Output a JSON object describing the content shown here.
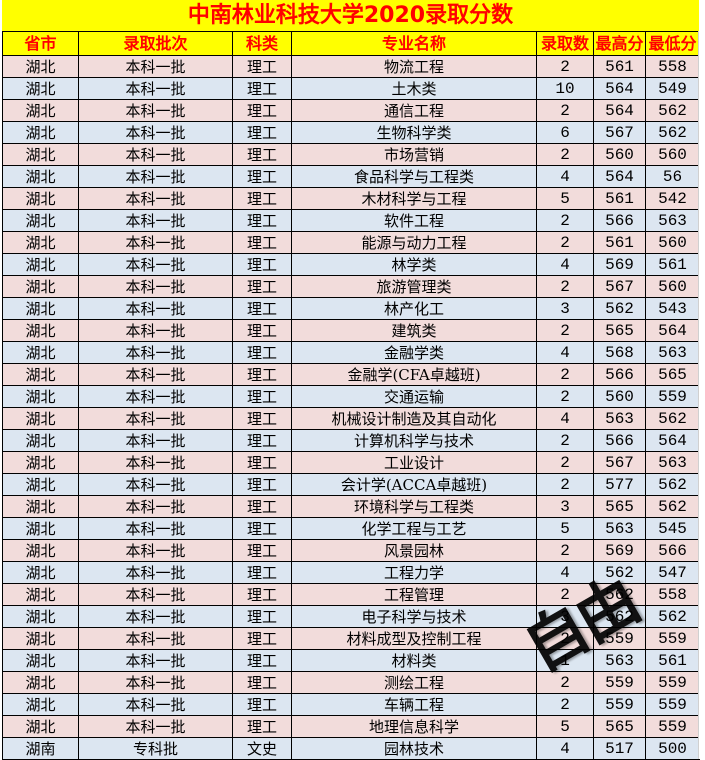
{
  "title": "中南林业科技大学2020录取分数",
  "colors": {
    "header_bg": "#ffff00",
    "header_text": "#ff0000",
    "row_pink": "#f2dcdb",
    "row_blue": "#dce6f1"
  },
  "table": {
    "headers": [
      "省市",
      "录取批次",
      "科类",
      "专业名称",
      "录取数",
      "最高分",
      "最低分"
    ],
    "rows": [
      [
        "湖北",
        "本科一批",
        "理工",
        "物流工程",
        "2",
        "561",
        "558"
      ],
      [
        "湖北",
        "本科一批",
        "理工",
        "土木类",
        "10",
        "564",
        "549"
      ],
      [
        "湖北",
        "本科一批",
        "理工",
        "通信工程",
        "2",
        "564",
        "562"
      ],
      [
        "湖北",
        "本科一批",
        "理工",
        "生物科学类",
        "6",
        "567",
        "562"
      ],
      [
        "湖北",
        "本科一批",
        "理工",
        "市场营销",
        "2",
        "560",
        "560"
      ],
      [
        "湖北",
        "本科一批",
        "理工",
        "食品科学与工程类",
        "4",
        "564",
        "56"
      ],
      [
        "湖北",
        "本科一批",
        "理工",
        "木材科学与工程",
        "5",
        "561",
        "542"
      ],
      [
        "湖北",
        "本科一批",
        "理工",
        "软件工程",
        "2",
        "566",
        "563"
      ],
      [
        "湖北",
        "本科一批",
        "理工",
        "能源与动力工程",
        "2",
        "561",
        "560"
      ],
      [
        "湖北",
        "本科一批",
        "理工",
        "林学类",
        "4",
        "569",
        "561"
      ],
      [
        "湖北",
        "本科一批",
        "理工",
        "旅游管理类",
        "2",
        "567",
        "560"
      ],
      [
        "湖北",
        "本科一批",
        "理工",
        "林产化工",
        "3",
        "562",
        "543"
      ],
      [
        "湖北",
        "本科一批",
        "理工",
        "建筑类",
        "2",
        "565",
        "564"
      ],
      [
        "湖北",
        "本科一批",
        "理工",
        "金融学类",
        "4",
        "568",
        "563"
      ],
      [
        "湖北",
        "本科一批",
        "理工",
        "金融学(CFA卓越班)",
        "2",
        "566",
        "565"
      ],
      [
        "湖北",
        "本科一批",
        "理工",
        "交通运输",
        "2",
        "560",
        "559"
      ],
      [
        "湖北",
        "本科一批",
        "理工",
        "机械设计制造及其自动化",
        "4",
        "563",
        "562"
      ],
      [
        "湖北",
        "本科一批",
        "理工",
        "计算机科学与技术",
        "2",
        "566",
        "564"
      ],
      [
        "湖北",
        "本科一批",
        "理工",
        "工业设计",
        "2",
        "567",
        "563"
      ],
      [
        "湖北",
        "本科一批",
        "理工",
        "会计学(ACCA卓越班)",
        "2",
        "577",
        "562"
      ],
      [
        "湖北",
        "本科一批",
        "理工",
        "环境科学与工程类",
        "3",
        "565",
        "562"
      ],
      [
        "湖北",
        "本科一批",
        "理工",
        "化学工程与工艺",
        "5",
        "563",
        "545"
      ],
      [
        "湖北",
        "本科一批",
        "理工",
        "风景园林",
        "2",
        "569",
        "566"
      ],
      [
        "湖北",
        "本科一批",
        "理工",
        "工程力学",
        "4",
        "562",
        "547"
      ],
      [
        "湖北",
        "本科一批",
        "理工",
        "工程管理",
        "2",
        "562",
        "558"
      ],
      [
        "湖北",
        "本科一批",
        "理工",
        "电子科学与技术",
        "3",
        "562",
        "562"
      ],
      [
        "湖北",
        "本科一批",
        "理工",
        "材料成型及控制工程",
        "2",
        "559",
        "559"
      ],
      [
        "湖北",
        "本科一批",
        "理工",
        "材料类",
        "1",
        "563",
        "561"
      ],
      [
        "湖北",
        "本科一批",
        "理工",
        "测绘工程",
        "2",
        "559",
        "559"
      ],
      [
        "湖北",
        "本科一批",
        "理工",
        "车辆工程",
        "2",
        "559",
        "559"
      ],
      [
        "湖北",
        "本科一批",
        "理工",
        "地理信息科学",
        "5",
        "565",
        "559"
      ],
      [
        "湖南",
        "专科批",
        "文史",
        "园林技术",
        "4",
        "517",
        "500"
      ]
    ]
  },
  "watermark": "自由"
}
